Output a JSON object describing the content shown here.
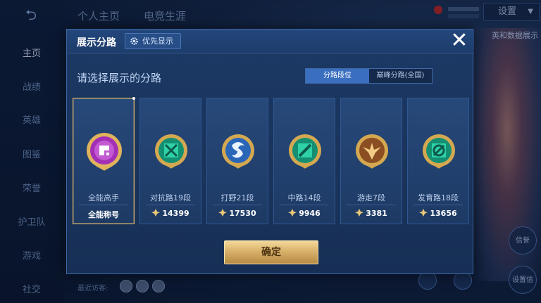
{
  "background": {
    "nav_items": [
      "主页",
      "战绩",
      "英雄",
      "图鉴",
      "荣誉",
      "护卫队",
      "游戏",
      "社交"
    ],
    "active_nav": "主页",
    "tabs": [
      "个人主页",
      "电竞生涯"
    ],
    "settings_label": "设置",
    "right_link": "英和数据展示",
    "side_buttons": [
      "信誉",
      "设置信"
    ],
    "recent_visitors_label": "最近访客:"
  },
  "modal": {
    "title": "展示分路",
    "priority_label": "优先显示",
    "close_label": "✕",
    "subtitle": "请选择展示的分路",
    "toggle": {
      "options": [
        "分路段位",
        "巅峰分路(全国)"
      ],
      "selected": "分路段位"
    },
    "cards": [
      {
        "name": "全能高手",
        "stat": "全能称号",
        "icon": "all-round-badge-icon",
        "color": "#b13ec4",
        "selected": true
      },
      {
        "name": "对抗路19段",
        "stat": "14399",
        "icon": "clash-lane-badge-icon",
        "color": "#1fb58e",
        "selected": false
      },
      {
        "name": "打野21段",
        "stat": "17530",
        "icon": "jungle-badge-icon",
        "color": "#3a7fd0",
        "selected": false
      },
      {
        "name": "中路14段",
        "stat": "9946",
        "icon": "mid-lane-badge-icon",
        "color": "#1fb58e",
        "selected": false
      },
      {
        "name": "游走7段",
        "stat": "3381",
        "icon": "roam-badge-icon",
        "color": "#b87a3a",
        "selected": false
      },
      {
        "name": "发育路18段",
        "stat": "13656",
        "icon": "farm-lane-badge-icon",
        "color": "#1fb58e",
        "selected": false
      }
    ],
    "confirm_label": "确定"
  },
  "colors": {
    "accent": "#3a6fc0",
    "gold": "#d9b16a",
    "modal_bg": "#1c3a66"
  }
}
